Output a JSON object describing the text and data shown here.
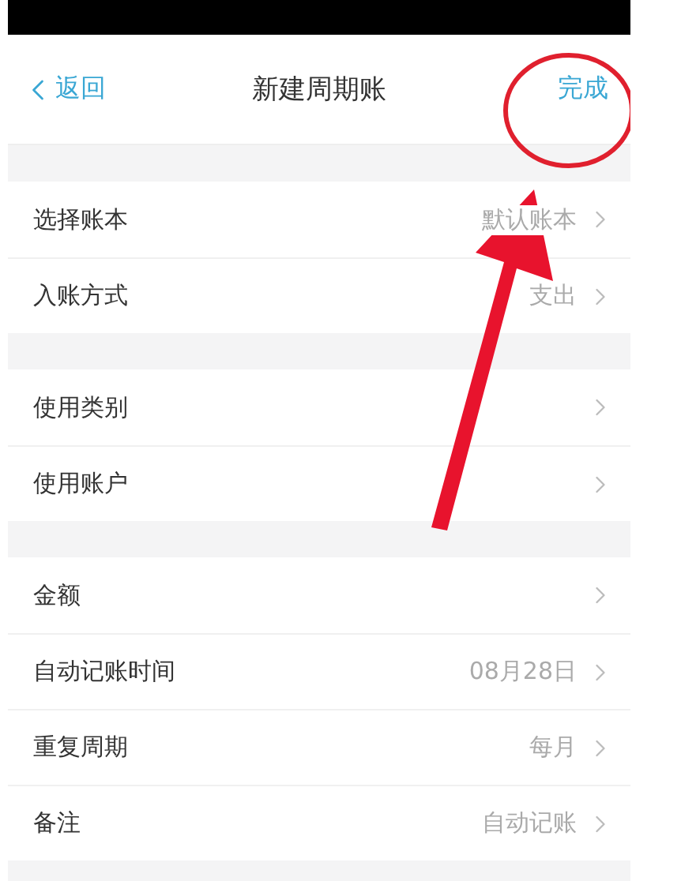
{
  "nav": {
    "back": "返回",
    "title": "新建周期账",
    "done": "完成"
  },
  "sections": [
    [
      {
        "label": "选择账本",
        "value": "默认账本"
      },
      {
        "label": "入账方式",
        "value": "支出"
      }
    ],
    [
      {
        "label": "使用类别"
      },
      {
        "label": "使用账户"
      }
    ],
    [
      {
        "label": "金额"
      },
      {
        "label": "自动记账时间",
        "value": "08月28日"
      },
      {
        "label": "重复周期",
        "value": "每月"
      },
      {
        "label": "备注",
        "value": "自动记账"
      }
    ]
  ]
}
